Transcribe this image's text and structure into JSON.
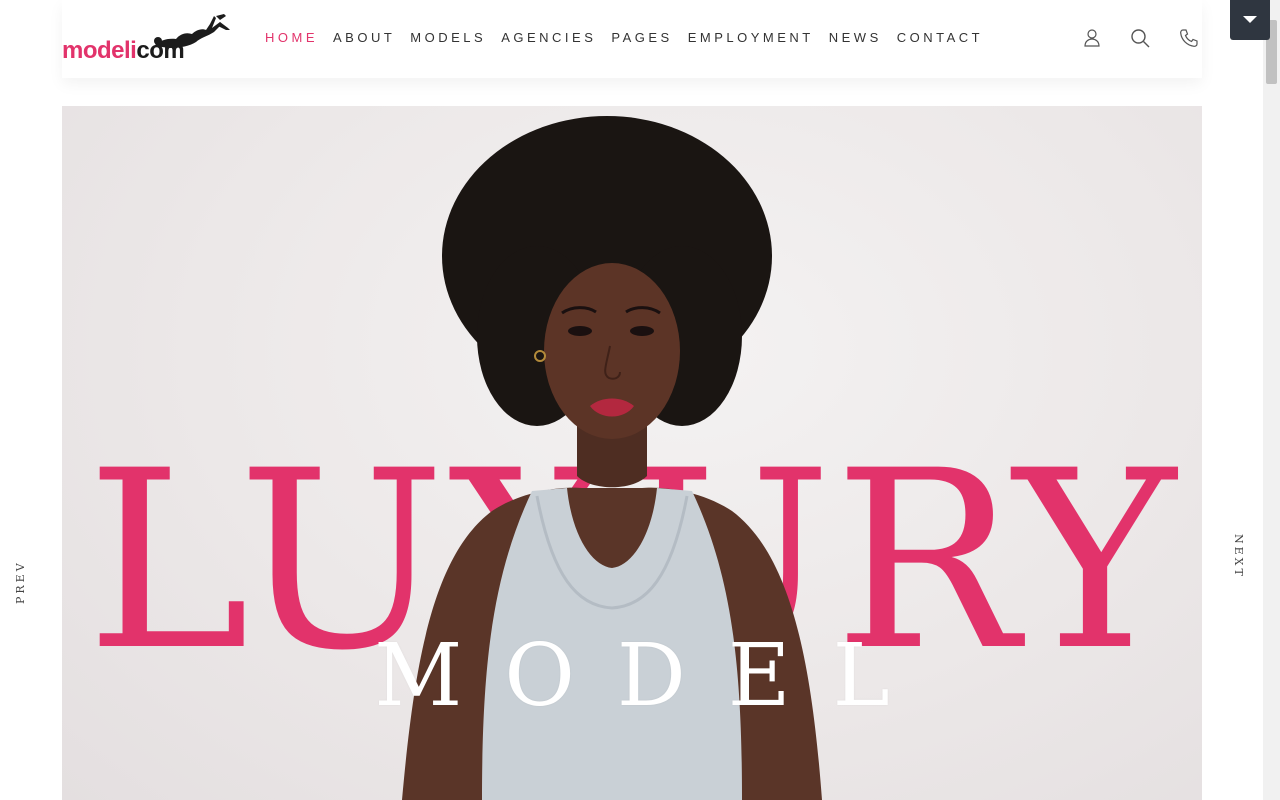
{
  "brand": {
    "logo_part1": "modeli",
    "logo_part2": "com",
    "colors": {
      "accent": "#e2336b",
      "dark": "#1c1c1c",
      "tab": "#2f3640"
    }
  },
  "nav": {
    "items": [
      {
        "label": "HOME",
        "active": true
      },
      {
        "label": "ABOUT"
      },
      {
        "label": "MODELS"
      },
      {
        "label": "AGENCIES"
      },
      {
        "label": "PAGES"
      },
      {
        "label": "EMPLOYMENT"
      },
      {
        "label": "NEWS"
      },
      {
        "label": "CONTACT"
      }
    ]
  },
  "header_icons": [
    "user-icon",
    "search-icon",
    "phone-icon"
  ],
  "hero": {
    "headline": "LUXURY",
    "subheadline": "MODEL"
  },
  "slider": {
    "prev_label": "PREV",
    "next_label": "NEXT"
  }
}
